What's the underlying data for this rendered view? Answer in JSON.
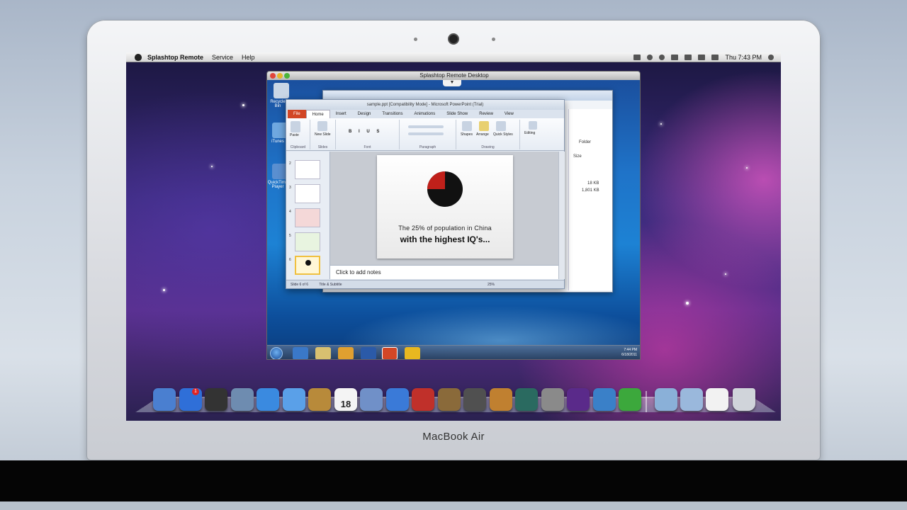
{
  "mac_menubar": {
    "app_name": "Splashtop Remote",
    "menus": [
      "Service",
      "Help"
    ],
    "clock": "Thu 7:43 PM"
  },
  "splashtop": {
    "window_title": "Splashtop Remote Desktop",
    "toggle_glyph": "▼"
  },
  "windows_desktop": {
    "icons": [
      {
        "label": "Recycle Bin",
        "color": "#c9d6e6"
      },
      {
        "label": "iTunes",
        "color": "#6fa8e0"
      },
      {
        "label": "QuickTime Player",
        "color": "#5a8fd0"
      }
    ]
  },
  "explorer": {
    "folder_label": "Folder",
    "size_header": "Size",
    "sizes": [
      "18 KB",
      "1,801 KB"
    ]
  },
  "powerpoint": {
    "title": "sample.ppt [Compatibility Mode] - Microsoft PowerPoint (Trial)",
    "tabs": {
      "file": "File",
      "home": "Home",
      "insert": "Insert",
      "design": "Design",
      "transitions": "Transitions",
      "animations": "Animations",
      "slide_show": "Slide Show",
      "review": "Review",
      "view": "View"
    },
    "ribbon_groups": {
      "clipboard": "Clipboard",
      "slides": "Slides",
      "font": "Font",
      "paragraph": "Paragraph",
      "drawing": "Drawing",
      "editing": "Editing"
    },
    "ribbon_buttons": {
      "paste": "Paste",
      "new_slide": "New Slide",
      "shapes": "Shapes",
      "arrange": "Arrange",
      "quick_styles": "Quick Styles",
      "editing": "Editing"
    },
    "thumbnail_numbers": [
      "2",
      "3",
      "4",
      "5",
      "6"
    ],
    "slide": {
      "line1": "The 25% of population in China",
      "line2": "with the highest IQ's...",
      "pie_highlight_fraction": 0.25,
      "pie_colors": {
        "main": "#111111",
        "slice": "#c0201a"
      }
    },
    "notes_placeholder": "Click to add notes",
    "status": {
      "slide": "Slide 6 of 6",
      "theme": "Title & Subtitle",
      "zoom": "25%"
    }
  },
  "taskbar": {
    "time": "7:44 PM",
    "date": "6/18/2011"
  },
  "dock": {
    "mail_badge": "1",
    "calendar_day": "18",
    "icons": [
      {
        "name": "finder-icon",
        "color": "#4a7fd0"
      },
      {
        "name": "app-store-icon",
        "color": "#2f6fd8"
      },
      {
        "name": "dashboard-icon",
        "color": "#333333"
      },
      {
        "name": "mail-icon",
        "color": "#6e8cb0"
      },
      {
        "name": "safari-icon",
        "color": "#3a8ae0"
      },
      {
        "name": "facetime-icon",
        "color": "#5aa0e8"
      },
      {
        "name": "address-book-icon",
        "color": "#b88a3a"
      },
      {
        "name": "ical-icon",
        "color": "#f4f4f4"
      },
      {
        "name": "photo-booth-icon",
        "color": "#7090c8"
      },
      {
        "name": "itunes-icon",
        "color": "#3a7ad8"
      },
      {
        "name": "photo-icon",
        "color": "#c0302a"
      },
      {
        "name": "iphoto-icon",
        "color": "#8a6a3a"
      },
      {
        "name": "imovie-icon",
        "color": "#505050"
      },
      {
        "name": "garageband-icon",
        "color": "#c08030"
      },
      {
        "name": "time-machine-icon",
        "color": "#2a6a60"
      },
      {
        "name": "system-preferences-icon",
        "color": "#8a8a8a"
      },
      {
        "name": "hd-app-icon",
        "color": "#5a2a8a"
      },
      {
        "name": "network-icon",
        "color": "#3a80c8"
      },
      {
        "name": "splashtop-icon",
        "color": "#3ca83c"
      }
    ]
  },
  "laptop": {
    "brand": "MacBook",
    "model": "Air"
  }
}
